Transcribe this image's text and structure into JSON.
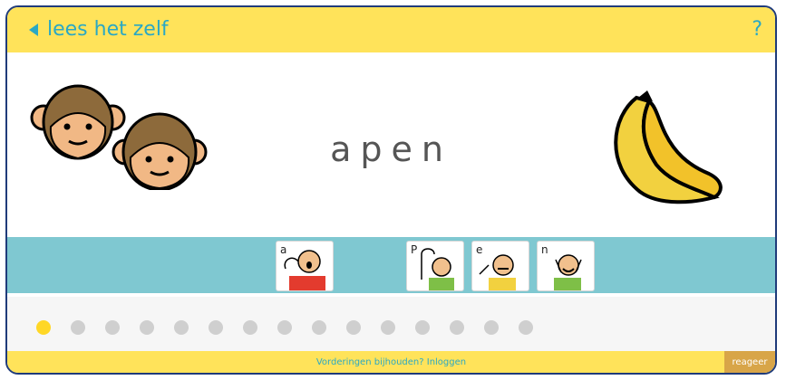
{
  "header": {
    "back_label": "lees het zelf",
    "help_label": "?"
  },
  "main": {
    "word": "apen",
    "sign_cards": [
      {
        "letter": "a"
      },
      {
        "letter": "P"
      },
      {
        "letter": "e"
      },
      {
        "letter": "n"
      }
    ]
  },
  "progress": {
    "current": 1,
    "total": 15
  },
  "footer": {
    "note": "Vorderingen bijhouden? Inloggen",
    "react_label": "reageer"
  },
  "colors": {
    "header": "#ffe35a",
    "accent": "#2aa8c4",
    "band": "#7fc8d1",
    "progress_active": "#ffd726"
  }
}
